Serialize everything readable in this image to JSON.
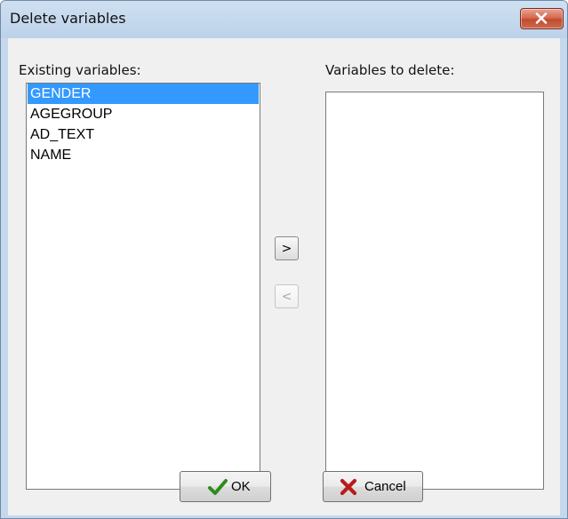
{
  "window": {
    "title": "Delete variables"
  },
  "existing": {
    "label": "Existing variables:",
    "items": [
      "GENDER",
      "AGEGROUP",
      "AD_TEXT",
      "NAME"
    ],
    "selected_item": "GENDER"
  },
  "to_delete": {
    "label": "Variables to delete:",
    "items": []
  },
  "move_buttons": {
    "add_label": ">",
    "remove_label": "<",
    "remove_enabled": false
  },
  "footer": {
    "ok_label": "OK",
    "cancel_label": "Cancel"
  },
  "colors": {
    "selection": "#3399ff",
    "ok_check": "#2e8b1e",
    "cancel_x": "#b71c1c",
    "close_button": "#c24a2f"
  },
  "icons": {
    "close": "close-icon",
    "ok": "checkmark-icon",
    "cancel": "x-icon"
  }
}
